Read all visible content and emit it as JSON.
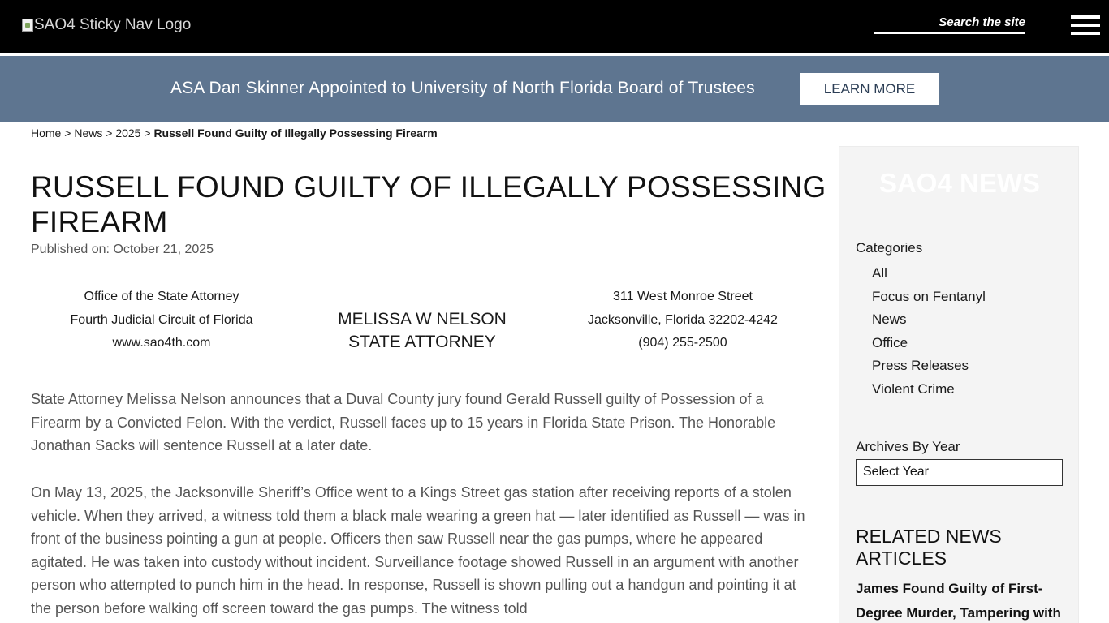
{
  "nav": {
    "logo_alt": "SAO4 Sticky Nav Logo",
    "search_placeholder": "Search the site"
  },
  "banner": {
    "text": "ASA Dan Skinner Appointed to University of North Florida Board of Trustees",
    "button_label": "LEARN MORE"
  },
  "breadcrumb": {
    "items": [
      "Home",
      "News",
      "2025"
    ],
    "separator": ">",
    "current": "Russell Found Guilty of Illegally Possessing Firearm"
  },
  "article": {
    "title": "RUSSELL FOUND GUILTY OF ILLEGALLY POSSESSING FIREARM",
    "published": "Published on: October 21, 2025",
    "letterhead": {
      "left": [
        "Office of the State Attorney",
        "Fourth Judicial Circuit of Florida",
        "www.sao4th.com"
      ],
      "center": [
        "MELISSA W NELSON",
        "STATE ATTORNEY"
      ],
      "right": [
        "311 West Monroe Street",
        "Jacksonville, Florida 32202-4242",
        "(904) 255-2500"
      ]
    },
    "paragraphs": [
      "State Attorney Melissa Nelson announces that a Duval County jury found Gerald Russell guilty of Possession of a Firearm by a Convicted Felon. With the verdict, Russell faces up to 15 years in Florida State Prison. The Honorable Jonathan Sacks will sentence Russell at a later date.",
      "On May 13, 2025, the Jacksonville Sheriff’s Office went to a Kings Street gas station after receiving reports of a stolen vehicle. When they arrived, a witness told them a black male wearing a green hat — later identified as Russell — was in front of the business pointing a gun at people. Officers then saw Russell near the gas pumps, where he appeared agitated. He was taken into custody without incident. Surveillance footage showed Russell in an argument with another person who attempted to punch him in the head. In response, Russell is shown pulling out a handgun and pointing it at the person before walking off screen toward the gas pumps. The witness told"
    ]
  },
  "sidebar": {
    "heading": "SAO4 NEWS",
    "categories_label": "Categories",
    "categories": [
      "All",
      "Focus on Fentanyl",
      "News",
      "Office",
      "Press Releases",
      "Violent Crime"
    ],
    "archives_label": "Archives By Year",
    "archives_selected": "Select Year",
    "related_heading": "RELATED NEWS ARTICLES",
    "related_articles": [
      "James Found Guilty of First-Degree Murder, Tampering with"
    ]
  },
  "colors": {
    "nav_bg": "#000000",
    "banner_bg": "#5e7590",
    "sidebar_bg": "#f4f4f4",
    "body_text": "#555555"
  }
}
